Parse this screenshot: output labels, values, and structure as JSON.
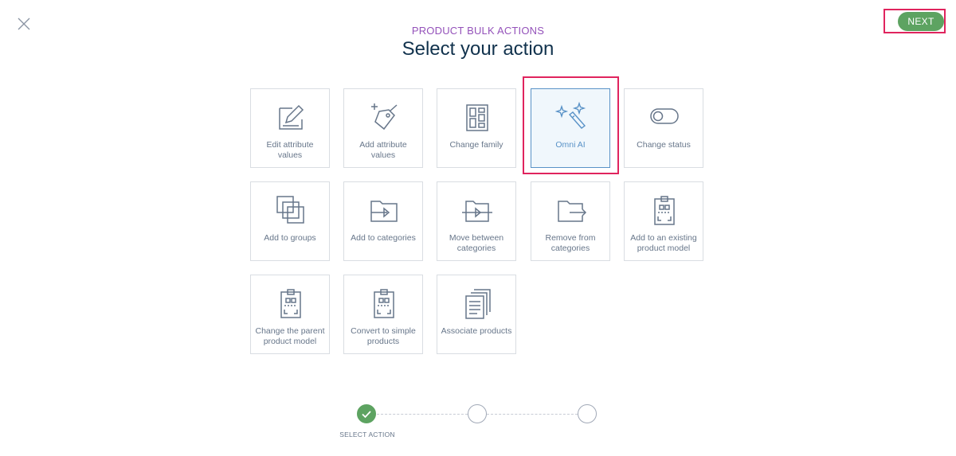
{
  "header": {
    "close_icon": "close-icon",
    "subtitle": "PRODUCT BULK ACTIONS",
    "title": "Select your action",
    "next_label": "NEXT"
  },
  "actions": [
    {
      "label": "Edit attribute values",
      "icon": "edit-icon",
      "selected": false
    },
    {
      "label": "Add attribute values",
      "icon": "tag-plus-icon",
      "selected": false
    },
    {
      "label": "Change family",
      "icon": "family-icon",
      "selected": false
    },
    {
      "label": "Omni AI",
      "icon": "magic-wand-icon",
      "selected": true
    },
    {
      "label": "Change status",
      "icon": "toggle-icon",
      "selected": false
    },
    {
      "label": "Add to groups",
      "icon": "groups-icon",
      "selected": false
    },
    {
      "label": "Add to categories",
      "icon": "folder-add-icon",
      "selected": false
    },
    {
      "label": "Move between categories",
      "icon": "folder-move-icon",
      "selected": false
    },
    {
      "label": "Remove from categories",
      "icon": "folder-remove-icon",
      "selected": false
    },
    {
      "label": "Add to an existing product model",
      "icon": "product-model-icon",
      "selected": false
    },
    {
      "label": "Change the parent product model",
      "icon": "product-model-icon",
      "selected": false
    },
    {
      "label": "Convert to simple products",
      "icon": "product-model-icon",
      "selected": false
    },
    {
      "label": "Associate products",
      "icon": "associate-icon",
      "selected": false
    }
  ],
  "steps": {
    "items": [
      {
        "state": "done",
        "label": "SELECT ACTION"
      },
      {
        "state": "pending"
      },
      {
        "state": "pending"
      }
    ]
  },
  "colors": {
    "accent_green": "#5da361",
    "subtitle_purple": "#9452ba",
    "title_navy": "#11324d",
    "selected_blue": "#5992c7",
    "highlight_red": "#e0245e"
  }
}
